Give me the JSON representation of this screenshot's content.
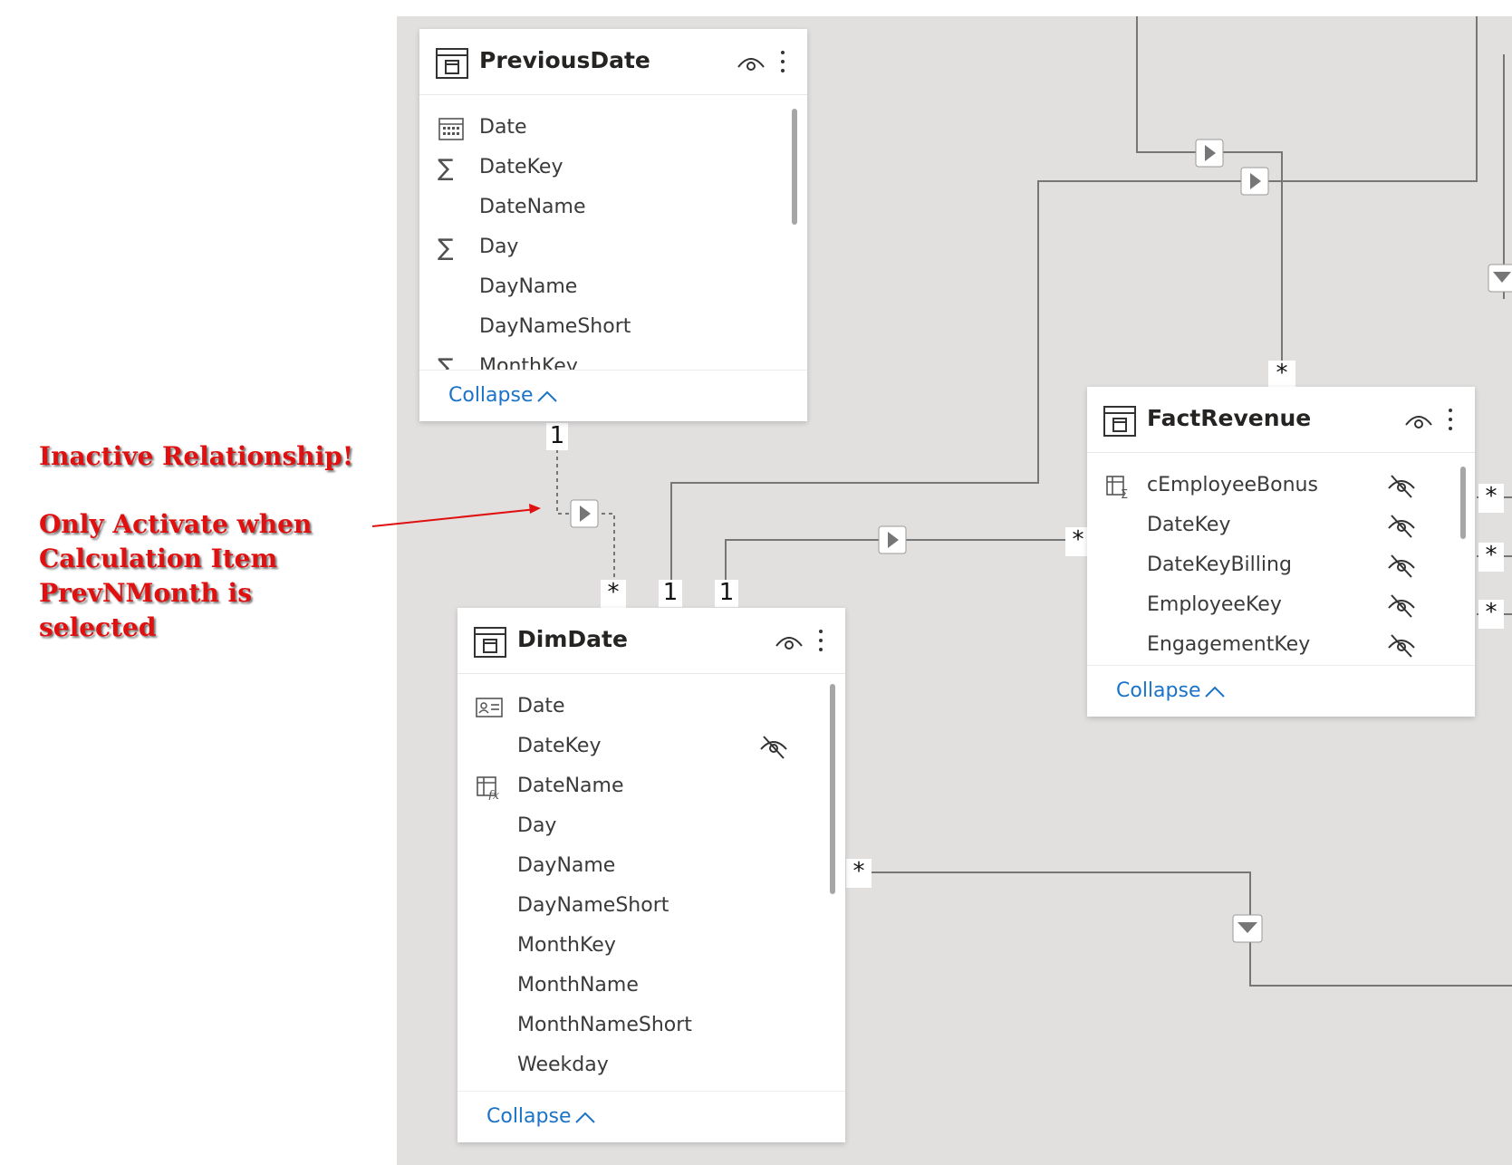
{
  "annotation": {
    "title": "Inactive Relationship!",
    "lines": [
      "Only Activate when",
      "Calculation Item",
      "PrevNMonth is",
      "selected"
    ]
  },
  "tables": {
    "previous_date": {
      "name": "PreviousDate",
      "fields": [
        {
          "label": "Date",
          "icon": "calendar-icon"
        },
        {
          "label": "DateKey",
          "icon": "sigma-icon"
        },
        {
          "label": "DateName",
          "icon": ""
        },
        {
          "label": "Day",
          "icon": "sigma-icon"
        },
        {
          "label": "DayName",
          "icon": ""
        },
        {
          "label": "DayNameShort",
          "icon": ""
        },
        {
          "label": "MonthKey",
          "icon": "sigma-icon"
        }
      ],
      "collapse_label": "Collapse"
    },
    "dim_date": {
      "name": "DimDate",
      "fields": [
        {
          "label": "Date",
          "icon": "id-card-icon"
        },
        {
          "label": "DateKey",
          "icon": "",
          "hidden": true
        },
        {
          "label": "DateName",
          "icon": "calculated-column-icon"
        },
        {
          "label": "Day",
          "icon": ""
        },
        {
          "label": "DayName",
          "icon": ""
        },
        {
          "label": "DayNameShort",
          "icon": ""
        },
        {
          "label": "MonthKey",
          "icon": ""
        },
        {
          "label": "MonthName",
          "icon": ""
        },
        {
          "label": "MonthNameShort",
          "icon": ""
        },
        {
          "label": "Weekday",
          "icon": ""
        }
      ],
      "collapse_label": "Collapse"
    },
    "fact_revenue": {
      "name": "FactRevenue",
      "fields": [
        {
          "label": "cEmployeeBonus",
          "icon": "measure-table-icon",
          "hidden": true
        },
        {
          "label": "DateKey",
          "icon": "",
          "hidden": true
        },
        {
          "label": "DateKeyBilling",
          "icon": "",
          "hidden": true
        },
        {
          "label": "EmployeeKey",
          "icon": "",
          "hidden": true
        },
        {
          "label": "EngagementKey",
          "icon": "",
          "hidden": true
        }
      ],
      "collapse_label": "Collapse"
    }
  },
  "cardinality": {
    "one": "1",
    "many": "*"
  },
  "colors": {
    "annotation": "#e01010",
    "canvas": "#e1e0df",
    "link": "#1a73c9",
    "relationship_line": "#6e6e6e"
  }
}
